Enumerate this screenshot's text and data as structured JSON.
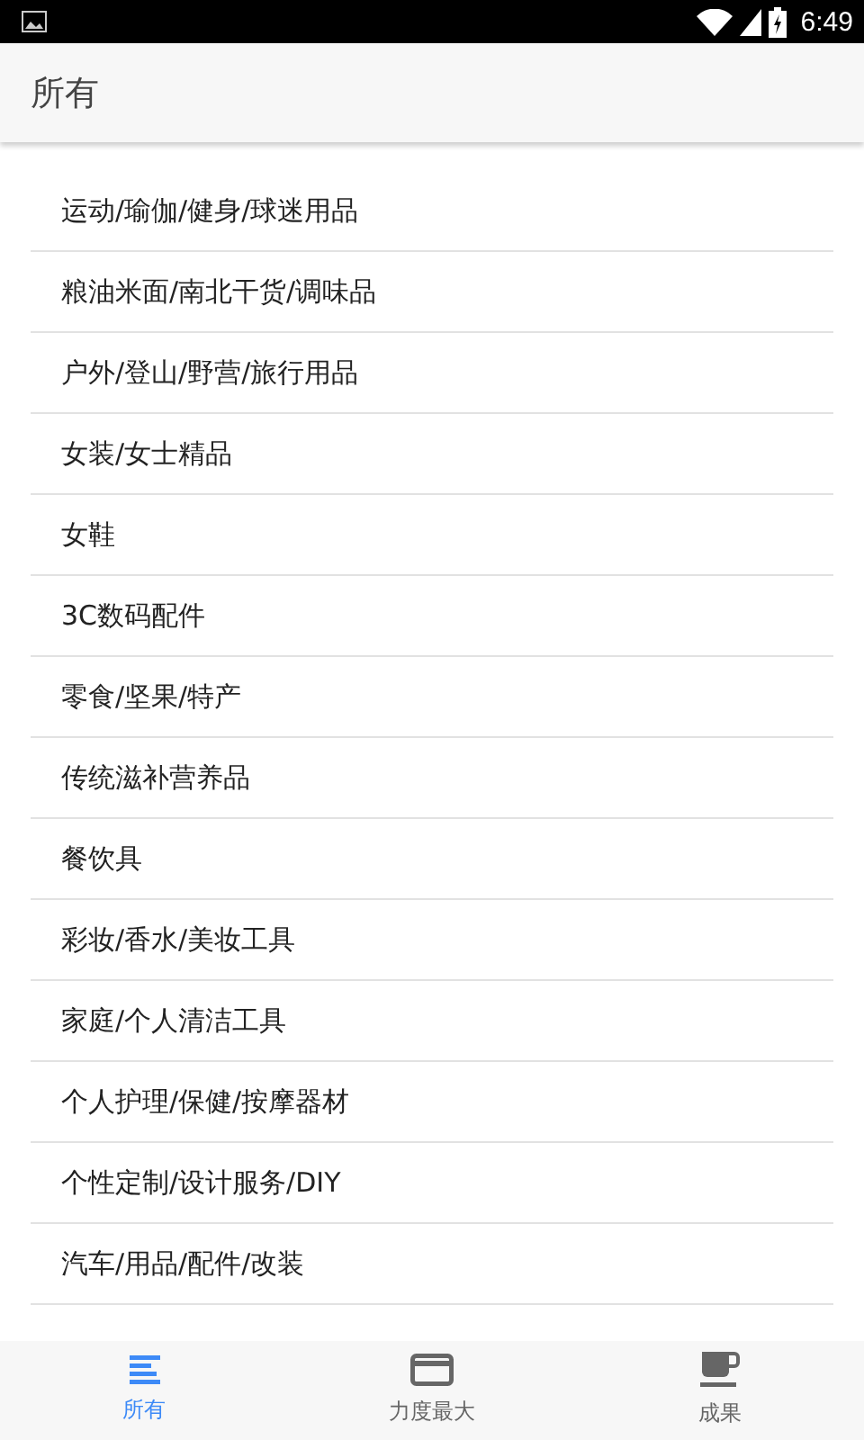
{
  "status_bar": {
    "time": "6:49"
  },
  "app_bar": {
    "title": "所有"
  },
  "categories": [
    "运动/瑜伽/健身/球迷用品",
    "粮油米面/南北干货/调味品",
    "户外/登山/野营/旅行用品",
    "女装/女士精品",
    "女鞋",
    "3C数码配件",
    "零食/坚果/特产",
    "传统滋补营养品",
    "餐饮具",
    "彩妆/香水/美妆工具",
    "家庭/个人清洁工具",
    "个人护理/保健/按摩器材",
    "个性定制/设计服务/DIY",
    "汽车/用品/配件/改装"
  ],
  "tabs": [
    {
      "label": "所有",
      "kind": "list",
      "selected": true
    },
    {
      "label": "力度最大",
      "kind": "card",
      "selected": false
    },
    {
      "label": "成果",
      "kind": "cup",
      "selected": false
    }
  ]
}
